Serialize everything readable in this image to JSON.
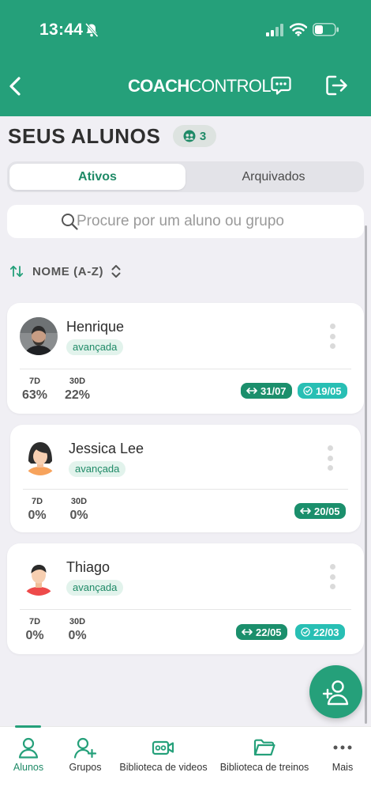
{
  "status_bar": {
    "time": "13:44"
  },
  "brand": {
    "bold": "COACH",
    "light": "CONTROL"
  },
  "page": {
    "title": "SEUS ALUNOS",
    "student_count": "3"
  },
  "tabs": {
    "active": "Ativos",
    "archived": "Arquivados"
  },
  "search": {
    "placeholder": "Procure por um aluno ou grupo",
    "value": ""
  },
  "sort": {
    "label": "NOME (A-Z)"
  },
  "students": [
    {
      "name": "Henrique",
      "level": "avançada",
      "stat_7d_label": "7D",
      "stat_7d": "63%",
      "stat_30d_label": "30D",
      "stat_30d": "22%",
      "chip_1": "31/07",
      "chip_2": "19/05"
    },
    {
      "name": "Jessica Lee",
      "level": "avançada",
      "stat_7d_label": "7D",
      "stat_7d": "0%",
      "stat_30d_label": "30D",
      "stat_30d": "0%",
      "chip_1": "20/05"
    },
    {
      "name": "Thiago",
      "level": "avançada",
      "stat_7d_label": "7D",
      "stat_7d": "0%",
      "stat_30d_label": "30D",
      "stat_30d": "0%",
      "chip_1": "22/05",
      "chip_2": "22/03"
    }
  ],
  "bottom_nav": [
    {
      "label": "Alunos",
      "icon": "user-icon"
    },
    {
      "label": "Grupos",
      "icon": "user-plus-icon"
    },
    {
      "label": "Biblioteca de videos",
      "icon": "video-icon"
    },
    {
      "label": "Biblioteca de treinos",
      "icon": "folder-icon"
    },
    {
      "label": "Mais",
      "icon": "more-icon"
    }
  ],
  "colors": {
    "brand_green": "#25a07a",
    "dark_green": "#1b8f6c",
    "teal": "#28bfb4",
    "badge_bg": "#e2f3ec",
    "background": "#f0eff4"
  }
}
